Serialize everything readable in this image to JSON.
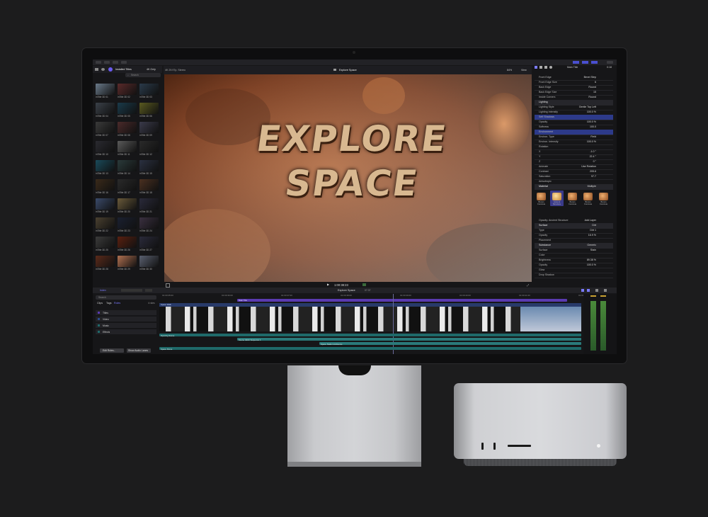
{
  "colors": {
    "accent": "#5b5ef0",
    "selected": "#2d3a8a",
    "title_lane": "#5a3ab0",
    "audio_lane": "#1f6a6a",
    "connected": "#3d7a6a"
  },
  "topbar": {
    "library_title": "Installed Titles",
    "library_filter": "4K Only",
    "project_label": "4K 29.97p, Stereo",
    "viewer_title": "Explore Space",
    "zoom": "84%",
    "view_menu": "View",
    "inspector_title": "Main Title",
    "inspector_time": "0:18"
  },
  "browser": {
    "search_placeholder": "Search",
    "thumbs": [
      {
        "label": "inTitle 3D 01",
        "c": "#6a7a8a"
      },
      {
        "label": "inTitle 3D 02",
        "c": "#5a2a2a"
      },
      {
        "label": "inTitle 3D 03",
        "c": "#2a3a4a"
      },
      {
        "label": "inTitle 3D 04",
        "c": "#3a4048"
      },
      {
        "label": "inTitle 3D 05",
        "c": "#1a3a4a"
      },
      {
        "label": "inTitle 3D 06",
        "c": "#5a5a20"
      },
      {
        "label": "inTitle 3D 07",
        "c": "#3a3a3a"
      },
      {
        "label": "inTitle 3D 08",
        "c": "#4a2a2a"
      },
      {
        "label": "inTitle 3D 09",
        "c": "#3a3a4a"
      },
      {
        "label": "inTitle 3D 10",
        "c": "#2a2a30"
      },
      {
        "label": "inTitle 3D 11",
        "c": "#5a5a5a"
      },
      {
        "label": "inTitle 3D 12",
        "c": "#2a2a2a"
      },
      {
        "label": "inTitle 3D 13",
        "c": "#1a4a5a"
      },
      {
        "label": "inTitle 3D 14",
        "c": "#2a3a3a"
      },
      {
        "label": "inTitle 3D 15",
        "c": "#2a3040"
      },
      {
        "label": "inTitle 3D 16",
        "c": "#3a2a1a"
      },
      {
        "label": "inTitle 3D 17",
        "c": "#2a2a2a"
      },
      {
        "label": "inTitle 3D 18",
        "c": "#4a3020"
      },
      {
        "label": "inTitle 3D 19",
        "c": "#3a4a6a"
      },
      {
        "label": "inTitle 3D 20",
        "c": "#6a5a3a"
      },
      {
        "label": "inTitle 3D 21",
        "c": "#2a2a3a"
      },
      {
        "label": "inTitle 3D 22",
        "c": "#4a4030"
      },
      {
        "label": "inTitle 3D 23",
        "c": "#1a2030"
      },
      {
        "label": "inTitle 3D 24",
        "c": "#3a3040"
      },
      {
        "label": "inTitle 3D 25",
        "c": "#3a3a3a"
      },
      {
        "label": "inTitle 3D 26",
        "c": "#5a2010"
      },
      {
        "label": "inTitle 3D 27",
        "c": "#2a2a3a"
      },
      {
        "label": "inTitle 3D 28",
        "c": "#5a2a1a"
      },
      {
        "label": "inTitle 3D 29",
        "c": "#b07050"
      },
      {
        "label": "inTitle 3D 30",
        "c": "#5a6070"
      }
    ]
  },
  "viewer": {
    "title_line1": "EXPLORE",
    "title_line2": "SPACE",
    "timecode": "1:00:38:23"
  },
  "inspector": {
    "rows": [
      {
        "l": "Front Edge",
        "v": "Bevel Step",
        "h": false
      },
      {
        "l": "Front Edge Size",
        "v": "6",
        "h": false
      },
      {
        "l": "Back Edge",
        "v": "Round",
        "h": false
      },
      {
        "l": "Back Edge Size",
        "v": "15",
        "h": false
      },
      {
        "l": "Inside Corners",
        "v": "Round",
        "h": false
      },
      {
        "l": "Lighting",
        "v": "",
        "h": true
      },
      {
        "l": "Lighting Style",
        "v": "Gentle Top Left",
        "h": false
      },
      {
        "l": "Lighting Intensity",
        "v": "100.0 %",
        "h": false
      },
      {
        "l": "Self Shadows",
        "v": "",
        "h": true
      },
      {
        "l": "Opacity",
        "v": "100.0 %",
        "h": false
      },
      {
        "l": "Softness",
        "v": "100.0",
        "h": false
      },
      {
        "l": "Environment",
        "v": "",
        "h": true
      },
      {
        "l": "Environ. Type",
        "v": "Field",
        "h": false
      },
      {
        "l": "Environ. Intensity",
        "v": "100.0 %",
        "h": false
      },
      {
        "l": "Rotation",
        "v": "",
        "h": false
      },
      {
        "l": "X",
        "v": "-1.0 °",
        "h": false
      },
      {
        "l": "Y",
        "v": "22.4 °",
        "h": false
      },
      {
        "l": "Z",
        "v": "0 °",
        "h": false
      },
      {
        "l": "Animate",
        "v": "Use Rotation",
        "h": false
      },
      {
        "l": "Contrast",
        "v": "205.6",
        "h": false
      },
      {
        "l": "Saturation",
        "v": "97.7",
        "h": false
      },
      {
        "l": "Anisotropic",
        "v": "",
        "h": false
      }
    ],
    "material_label": "Material",
    "material_value": "Multiple",
    "materials": [
      "Brown Concrete",
      "Ancient Structure",
      "Brown Concrete",
      "Brown Concrete",
      "Brown Concrete"
    ],
    "rows2": [
      {
        "l": "Opacity: Ancient Structure",
        "v": "Add Layer",
        "h": false
      },
      {
        "l": "Surface",
        "v": "Dirt",
        "h": true
      },
      {
        "l": "Type",
        "v": "Dirt 1",
        "h": false
      },
      {
        "l": "Opacity",
        "v": "16.9 %",
        "h": false
      },
      {
        "l": "Placement",
        "v": "",
        "h": false
      },
      {
        "l": "Substance",
        "v": "Generic",
        "h": true
      },
      {
        "l": "Surface",
        "v": "Stain",
        "h": false
      },
      {
        "l": "Color",
        "v": "",
        "h": false
      },
      {
        "l": "Brightness",
        "v": "89.38 %",
        "h": false
      },
      {
        "l": "Opacity",
        "v": "100.0 %",
        "h": false
      },
      {
        "l": "Glow",
        "v": "",
        "h": false
      },
      {
        "l": "Drop Shadow",
        "v": "",
        "h": false
      }
    ]
  },
  "timeline": {
    "index_label": "Index",
    "project_name": "Explore Space",
    "project_duration": "07:37",
    "search_placeholder": "Search",
    "tabs": [
      "Clips",
      "Tags",
      "Roles"
    ],
    "roles_count": "4 roles",
    "roles": [
      "Titles",
      "Video",
      "Music",
      "Effects"
    ],
    "edit_roles": "Edit Roles...",
    "show_audio_lanes": "Show Audio Lanes",
    "ruler": [
      "01:00:35:00",
      "01:00:36:00",
      "01:00:37:00",
      "01:00:38:00",
      "01:00:39:00",
      "01:00:40:00",
      "01:00:41:00",
      "01:00:42:00"
    ],
    "title_clip": "Main Title",
    "video_clip": "Space Walk",
    "audio_clips": [
      "Opening Scene",
      "Scene Glitch Sequence 1",
      "Space Station Ambience",
      "Space Drone"
    ]
  }
}
